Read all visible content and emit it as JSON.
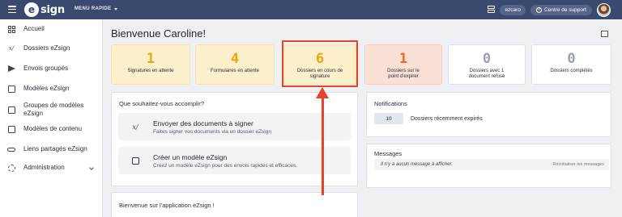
{
  "topbar": {
    "logo_text": "sign",
    "logo_letter": "e",
    "menu_rapide": "MENU RAPIDE",
    "user": "ezcaro",
    "support": "Centre de support"
  },
  "sidebar": {
    "items": [
      {
        "label": "Accueil",
        "icon": "dashboard-icon"
      },
      {
        "label": "Dossiers eZsign",
        "icon": "signature-icon"
      },
      {
        "label": "Envois groupés",
        "icon": "send-icon"
      },
      {
        "label": "Modèles eZsign",
        "icon": "template-icon"
      },
      {
        "label": "Groupes de modèles eZsign",
        "icon": "template-group-icon"
      },
      {
        "label": "Modèles de contenu",
        "icon": "content-template-icon"
      },
      {
        "label": "Liens partagés eZsign",
        "icon": "link-icon"
      },
      {
        "label": "Administration",
        "icon": "gear-icon"
      }
    ]
  },
  "main": {
    "title": "Bienvenue Caroline!",
    "stats": [
      {
        "value": "1",
        "label": "Signatures en attente",
        "tone": "yellow"
      },
      {
        "value": "4",
        "label": "Formulaires en attente",
        "tone": "yellow"
      },
      {
        "value": "6",
        "label": "Dossiers en cours de signature",
        "tone": "yellow"
      },
      {
        "value": "1",
        "label": "Dossiers sur le point d'expirer",
        "tone": "pink"
      },
      {
        "value": "0",
        "label": "Dossiers avec 1 document refusé",
        "tone": "white"
      },
      {
        "value": "0",
        "label": "Dossiers complétés",
        "tone": "white"
      }
    ],
    "actions": {
      "title": "Que souhaitez-vous accomplir?",
      "items": [
        {
          "title": "Envoyer des documents à signer",
          "desc": "Faites signer vos documents via un dossier eZsign"
        },
        {
          "title": "Créer un modèle eZsign",
          "desc": "Créez un modèle eZsign pour des envois rapides et efficaces."
        }
      ]
    },
    "notifications": {
      "title": "Notifications",
      "count": "10",
      "label": "Dossiers récemment expirés"
    },
    "messages": {
      "title": "Messages",
      "empty": "Il n'y a aucun message à afficher.",
      "reset": "Réinitialiser les messages"
    },
    "welcome": {
      "title": "Bienvenue sur l'application eZsign !"
    }
  },
  "colors": {
    "topbar": "#3a4a6e",
    "annotation": "#e4432c",
    "stat_yellow_bg": "#fcefcb",
    "stat_yellow_num": "#e9a618",
    "stat_pink_bg": "#fbe0d6",
    "stat_pink_num": "#e6692f"
  }
}
